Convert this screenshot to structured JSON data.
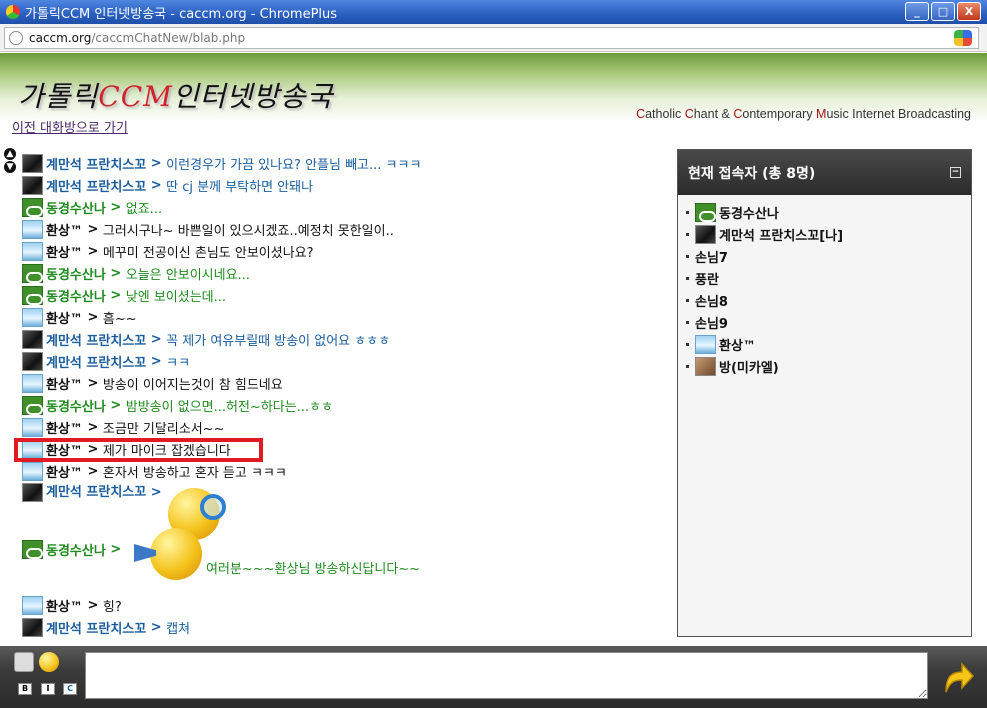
{
  "window": {
    "title": "가톨릭CCM 인터넷방송국 - caccm.org - ChromePlus",
    "buttons": {
      "minimize": "_",
      "maximize": "□",
      "close": "X"
    }
  },
  "address": {
    "host": "caccm.org",
    "path": "/caccmChatNew/blab.php"
  },
  "header": {
    "logo_pre": "가톨릭",
    "logo_ccm": "CCM",
    "logo_post": "인터넷방송국",
    "tagline_parts": [
      "C",
      "atholic ",
      "C",
      "hant & ",
      "C",
      "ontemporary ",
      "M",
      "usic Internet Broadcasting"
    ],
    "back_link": "이전 대화방으로 가기"
  },
  "chat": {
    "messages": [
      {
        "avatar": "dark",
        "nick": "계만석 프란치스꼬",
        "color": "blue",
        "text": "이런경우가 가끔 있나요? 안플님 빼고... ㅋㅋㅋ"
      },
      {
        "avatar": "dark",
        "nick": "계만석 프란치스꼬",
        "color": "blue",
        "text": "딴 cj 분께 부탁하면 안돼나"
      },
      {
        "avatar": "bike",
        "nick": "동경수산나",
        "color": "green",
        "text": "없죠..."
      },
      {
        "avatar": "sky",
        "nick": "환상™",
        "color": "black",
        "text": "그러시구나~ 바쁜일이 있으시겠죠..예정치 못한일이.."
      },
      {
        "avatar": "sky",
        "nick": "환상™",
        "color": "black",
        "text": "메꾸미 전공이신 촌님도 안보이셨나요?"
      },
      {
        "avatar": "bike",
        "nick": "동경수산나",
        "color": "green",
        "text": "오늘은 안보이시네요..."
      },
      {
        "avatar": "bike",
        "nick": "동경수산나",
        "color": "green",
        "text": "낮엔 보이셨는데..."
      },
      {
        "avatar": "sky",
        "nick": "환상™",
        "color": "black",
        "text": "흠~~"
      },
      {
        "avatar": "dark",
        "nick": "계만석 프란치스꼬",
        "color": "blue",
        "text": "꼭 제가 여유부릴때 방송이 없어요 ㅎㅎㅎ"
      },
      {
        "avatar": "dark",
        "nick": "계만석 프란치스꼬",
        "color": "blue",
        "text": "ㅋㅋ"
      },
      {
        "avatar": "sky",
        "nick": "환상™",
        "color": "black",
        "text": "방송이 이어지는것이 참 힘드네요"
      },
      {
        "avatar": "bike",
        "nick": "동경수산나",
        "color": "green",
        "text": "밤방송이 없으면...허전~하다는...ㅎㅎ"
      },
      {
        "avatar": "sky",
        "nick": "환상™",
        "color": "black",
        "text": "조금만 기달리소서~~"
      },
      {
        "avatar": "sky",
        "nick": "환상™",
        "color": "black",
        "text": "제가 마이크 잡겠습니다"
      },
      {
        "avatar": "sky",
        "nick": "환상™",
        "color": "black",
        "text": "혼자서 방송하고 혼자 듣고 ㅋㅋㅋ"
      }
    ],
    "emote_msg_1": {
      "nick": "계만석 프란치스꼬"
    },
    "emote_msg_2": {
      "nick": "동경수산나",
      "text": "여러분~~~환상님 방송하신답니다~~"
    },
    "tail_messages": [
      {
        "avatar": "sky",
        "nick": "환상™",
        "color": "black",
        "text": "힝?"
      },
      {
        "avatar": "dark",
        "nick": "계만석 프란치스꼬",
        "color": "blue",
        "text": "캡쳐"
      }
    ],
    "separator": " > "
  },
  "users": {
    "header": "현재 접속자 (총 8명)",
    "collapse": "−",
    "list": [
      {
        "avatar": "bike",
        "name": "동경수산나"
      },
      {
        "avatar": "dark",
        "name": "계만석 프란치스꼬[나]"
      },
      {
        "avatar": "",
        "name": "손님7"
      },
      {
        "avatar": "",
        "name": "풍란"
      },
      {
        "avatar": "",
        "name": "손님8"
      },
      {
        "avatar": "",
        "name": "손님9"
      },
      {
        "avatar": "sky",
        "name": "환상™"
      },
      {
        "avatar": "cat",
        "name": "방(미카엘)"
      }
    ]
  },
  "input": {
    "bold": "B",
    "italic": "I",
    "color": "C",
    "value": ""
  }
}
